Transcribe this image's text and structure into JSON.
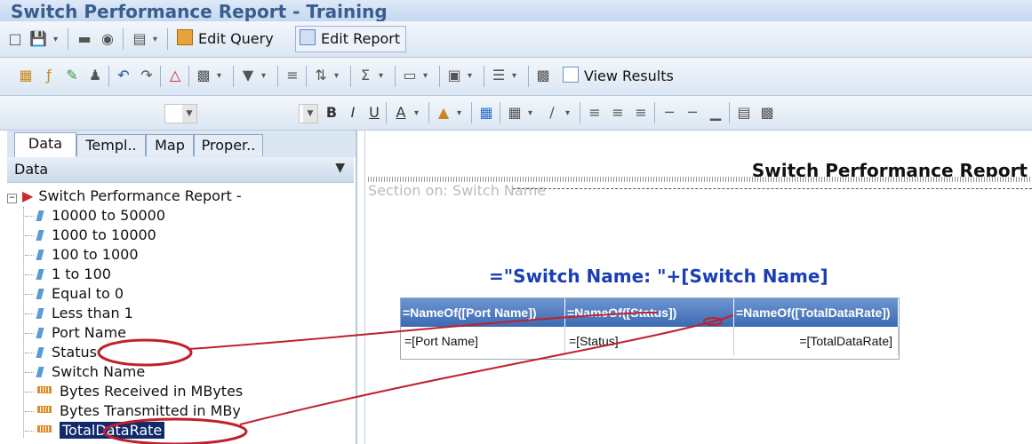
{
  "window": {
    "title": "Switch Performance Report - Training"
  },
  "toolbar1": {
    "edit_query": "Edit Query",
    "edit_report": "Edit Report"
  },
  "toolbar2": {
    "view_results": "View Results"
  },
  "left_panel": {
    "tabs": [
      "Data",
      "Templ..",
      "Map",
      "Proper.."
    ],
    "header": "Data",
    "tree_root": "Switch Performance Report -",
    "dimensions": [
      "10000 to 50000",
      "1000 to 10000",
      "100 to 1000",
      "1 to 100",
      "Equal to 0",
      "Less than 1",
      "Port Name",
      "Status",
      "Switch Name"
    ],
    "measures": [
      "Bytes Received in MBytes",
      "Bytes Transmitted in MBy",
      "TotalDataRate"
    ],
    "selected": "TotalDataRate"
  },
  "report": {
    "title": "Switch Performance Report",
    "section_label": "Section on: Switch Name",
    "block_header": "=\"Switch Name: \"+[Switch Name]",
    "table": {
      "headers": [
        "=NameOf([Port Name])",
        "=NameOf([Status])",
        "=NameOf([TotalDataRate])"
      ],
      "row": [
        "=[Port Name]",
        "=[Status]",
        "=[TotalDataRate]"
      ]
    }
  },
  "colors": {
    "title": "#3a5d8f",
    "selection": "#112a6c",
    "header_fill": "#4a78bf",
    "annotation": "#c0202a",
    "block_header": "#1a3fb5"
  }
}
